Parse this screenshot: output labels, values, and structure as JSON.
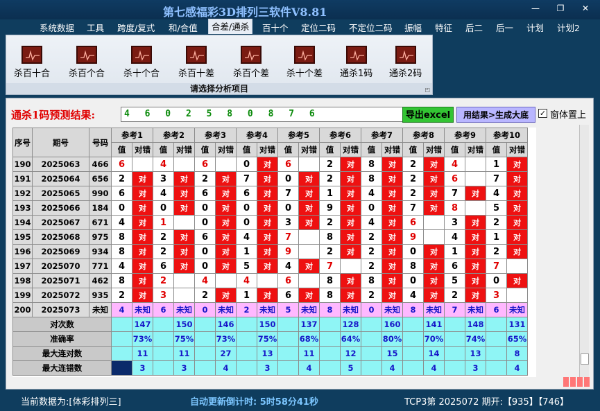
{
  "app_title": "第七感福彩3D排列三软件V8.81",
  "window_controls": [
    "—",
    "❐",
    "✕"
  ],
  "menu": [
    "系统数据",
    "工具",
    "跨度/复式",
    "和/合值",
    "合差/通杀",
    "百十个",
    "定位二码",
    "不定位二码",
    "振幅",
    "特征",
    "后二",
    "后一",
    "计划",
    "计划2"
  ],
  "active_menu": "合差/通杀",
  "ribbon": {
    "buttons": [
      "杀百十合",
      "杀百个合",
      "杀十个合",
      "杀百十差",
      "杀百个差",
      "杀十个差",
      "通杀1码",
      "通杀2码"
    ],
    "caption": "请选择分析项目"
  },
  "prediction": {
    "label": "通杀1码预测结果:",
    "value": "4 6 0 2 5 8 0 8 7 6",
    "excel_button": "导出excel",
    "gen_button": "用结果>生成大底",
    "top_checkbox": "窗体置上",
    "top_checked": true
  },
  "table": {
    "headers": {
      "seq": "序号",
      "period": "期号",
      "number": "号码",
      "refs": [
        "参考1",
        "参考2",
        "参考3",
        "参考4",
        "参考5",
        "参考6",
        "参考7",
        "参考8",
        "参考9",
        "参考10"
      ],
      "val": "值",
      "res": "对错"
    },
    "hit_text": "对",
    "rows": [
      {
        "seq": "190",
        "period": "2025063",
        "num": "466",
        "cells": [
          [
            "6",
            0,
            1
          ],
          [
            "4",
            0,
            1
          ],
          [
            "6",
            0,
            1
          ],
          [
            "0",
            1,
            0
          ],
          [
            "6",
            0,
            1
          ],
          [
            "2",
            1,
            0
          ],
          [
            "8",
            1,
            0
          ],
          [
            "2",
            1,
            0
          ],
          [
            "4",
            0,
            1
          ],
          [
            "1",
            1,
            0
          ]
        ]
      },
      {
        "seq": "191",
        "period": "2025064",
        "num": "656",
        "cells": [
          [
            "2",
            1,
            0
          ],
          [
            "3",
            1,
            0
          ],
          [
            "2",
            1,
            0
          ],
          [
            "7",
            1,
            0
          ],
          [
            "0",
            1,
            0
          ],
          [
            "2",
            1,
            0
          ],
          [
            "8",
            1,
            0
          ],
          [
            "2",
            1,
            0
          ],
          [
            "6",
            0,
            1
          ],
          [
            "7",
            1,
            0
          ]
        ]
      },
      {
        "seq": "192",
        "period": "2025065",
        "num": "990",
        "cells": [
          [
            "6",
            1,
            0
          ],
          [
            "4",
            1,
            0
          ],
          [
            "6",
            1,
            0
          ],
          [
            "6",
            1,
            0
          ],
          [
            "7",
            1,
            0
          ],
          [
            "1",
            1,
            0
          ],
          [
            "4",
            1,
            0
          ],
          [
            "2",
            1,
            0
          ],
          [
            "7",
            1,
            0
          ],
          [
            "4",
            1,
            0
          ]
        ]
      },
      {
        "seq": "193",
        "period": "2025066",
        "num": "184",
        "cells": [
          [
            "0",
            1,
            0
          ],
          [
            "0",
            1,
            0
          ],
          [
            "0",
            1,
            0
          ],
          [
            "0",
            1,
            0
          ],
          [
            "0",
            1,
            0
          ],
          [
            "9",
            1,
            0
          ],
          [
            "0",
            1,
            0
          ],
          [
            "7",
            1,
            0
          ],
          [
            "8",
            0,
            1
          ],
          [
            "5",
            1,
            0
          ]
        ]
      },
      {
        "seq": "194",
        "period": "2025067",
        "num": "671",
        "cells": [
          [
            "4",
            1,
            0
          ],
          [
            "1",
            0,
            1
          ],
          [
            "0",
            1,
            0
          ],
          [
            "0",
            1,
            0
          ],
          [
            "3",
            1,
            0
          ],
          [
            "2",
            1,
            0
          ],
          [
            "4",
            1,
            0
          ],
          [
            "6",
            0,
            1
          ],
          [
            "3",
            1,
            0
          ],
          [
            "2",
            1,
            0
          ]
        ]
      },
      {
        "seq": "195",
        "period": "2025068",
        "num": "975",
        "cells": [
          [
            "8",
            1,
            0
          ],
          [
            "2",
            1,
            0
          ],
          [
            "6",
            1,
            0
          ],
          [
            "4",
            1,
            0
          ],
          [
            "7",
            0,
            1
          ],
          [
            "8",
            1,
            0
          ],
          [
            "2",
            1,
            0
          ],
          [
            "9",
            0,
            1
          ],
          [
            "4",
            1,
            0
          ],
          [
            "1",
            1,
            0
          ]
        ]
      },
      {
        "seq": "196",
        "period": "2025069",
        "num": "934",
        "cells": [
          [
            "8",
            1,
            0
          ],
          [
            "2",
            1,
            0
          ],
          [
            "0",
            1,
            0
          ],
          [
            "1",
            1,
            0
          ],
          [
            "9",
            0,
            1
          ],
          [
            "2",
            1,
            0
          ],
          [
            "2",
            1,
            0
          ],
          [
            "0",
            1,
            0
          ],
          [
            "1",
            1,
            0
          ],
          [
            "2",
            1,
            0
          ]
        ]
      },
      {
        "seq": "197",
        "period": "2025070",
        "num": "771",
        "cells": [
          [
            "4",
            1,
            0
          ],
          [
            "6",
            1,
            0
          ],
          [
            "0",
            1,
            0
          ],
          [
            "5",
            1,
            0
          ],
          [
            "4",
            1,
            0
          ],
          [
            "7",
            0,
            1
          ],
          [
            "2",
            1,
            0
          ],
          [
            "8",
            1,
            0
          ],
          [
            "6",
            1,
            0
          ],
          [
            "7",
            0,
            1
          ]
        ]
      },
      {
        "seq": "198",
        "period": "2025071",
        "num": "462",
        "cells": [
          [
            "8",
            1,
            0
          ],
          [
            "2",
            0,
            1
          ],
          [
            "4",
            0,
            1
          ],
          [
            "4",
            0,
            1
          ],
          [
            "6",
            0,
            1
          ],
          [
            "8",
            1,
            0
          ],
          [
            "8",
            1,
            0
          ],
          [
            "0",
            1,
            0
          ],
          [
            "5",
            1,
            0
          ],
          [
            "0",
            1,
            0
          ]
        ]
      },
      {
        "seq": "199",
        "period": "2025072",
        "num": "935",
        "cells": [
          [
            "2",
            1,
            0
          ],
          [
            "3",
            0,
            1
          ],
          [
            "2",
            1,
            0
          ],
          [
            "1",
            1,
            0
          ],
          [
            "6",
            1,
            0
          ],
          [
            "8",
            1,
            0
          ],
          [
            "2",
            1,
            0
          ],
          [
            "4",
            1,
            0
          ],
          [
            "2",
            1,
            0
          ],
          [
            "3",
            0,
            1
          ]
        ]
      }
    ],
    "pred_row": {
      "seq": "200",
      "period": "2025073",
      "num": "未知",
      "vals": [
        "4",
        "6",
        "0",
        "2",
        "5",
        "8",
        "0",
        "8",
        "7",
        "6"
      ],
      "res": "未知"
    },
    "stats": [
      {
        "label": "对次数",
        "vals": [
          "147",
          "150",
          "146",
          "150",
          "137",
          "128",
          "160",
          "141",
          "148",
          "131"
        ]
      },
      {
        "label": "准确率",
        "vals": [
          "73%",
          "75%",
          "73%",
          "75%",
          "68%",
          "64%",
          "80%",
          "70%",
          "74%",
          "65%"
        ]
      },
      {
        "label": "最大连对数",
        "vals": [
          "11",
          "11",
          "27",
          "13",
          "11",
          "12",
          "15",
          "14",
          "13",
          "8"
        ]
      },
      {
        "label": "最大连错数",
        "vals": [
          "3",
          "3",
          "4",
          "3",
          "4",
          "5",
          "4",
          "4",
          "3",
          "4"
        ]
      }
    ]
  },
  "status": {
    "current": "当前数据为:[体彩排列三]",
    "countdown": "自动更新倒计时:  5时58分41秒",
    "latest": "TCP3第 2025072 期开:【935】【746】"
  },
  "colors": {
    "hit": "#ee1111",
    "pred_row": "#ffb8ff",
    "stats_row": "#8ff5f5",
    "accent_red": "#e00000"
  }
}
